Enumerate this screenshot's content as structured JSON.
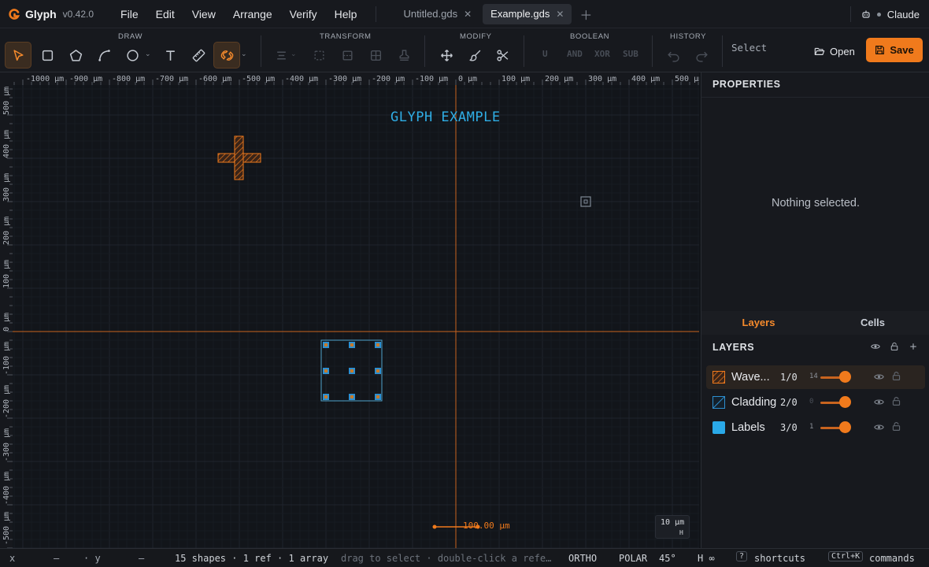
{
  "app": {
    "name": "Glyph",
    "version": "v0.42.0"
  },
  "menu": [
    "File",
    "Edit",
    "View",
    "Arrange",
    "Verify",
    "Help"
  ],
  "tabs": [
    {
      "label": "Untitled.gds",
      "active": false
    },
    {
      "label": "Example.gds",
      "active": true
    }
  ],
  "user": {
    "name": "Claude"
  },
  "toolbar": {
    "groups": {
      "draw": "DRAW",
      "transform": "TRANSFORM",
      "modify": "MODIFY",
      "boolean": "BOOLEAN",
      "history": "HISTORY"
    },
    "boolean_ops": [
      "U",
      "AND",
      "XOR",
      "SUB"
    ],
    "mode_text": "Select",
    "open_label": "Open",
    "save_label": "Save"
  },
  "rulers": {
    "x_ticks": [
      "-1000 µm",
      "-900 µm",
      "-800 µm",
      "-700 µm",
      "-600 µm",
      "-500 µm",
      "-400 µm",
      "-300 µm",
      "-200 µm",
      "-100 µm",
      "0 µm",
      "100 µm",
      "200 µm",
      "300 µm",
      "400 µm",
      "500 µm"
    ],
    "y_ticks": [
      "500 µm",
      "400 µm",
      "300 µm",
      "200 µm",
      "100 µm",
      "0 µm",
      "-100 µm",
      "-200 µm",
      "-300 µm",
      "-400 µm",
      "-500 µm"
    ]
  },
  "canvas": {
    "title_text": "GLYPH EXAMPLE",
    "scale_bar_label": "100.00 µm",
    "zoom_label": "10 µm",
    "zoom_sub": "H"
  },
  "properties": {
    "title": "PROPERTIES",
    "empty_text": "Nothing selected."
  },
  "panel_tabs": [
    "Layers",
    "Cells"
  ],
  "layers": {
    "title": "LAYERS",
    "items": [
      {
        "name": "Wave...",
        "number": "1/0",
        "count": "14",
        "color": "#f07a1c",
        "selected": true
      },
      {
        "name": "Cladding",
        "number": "2/0",
        "count": "0",
        "color": "#2d8fd0",
        "selected": false
      },
      {
        "name": "Labels",
        "number": "3/0",
        "count": "1",
        "color": "#2aa9e8",
        "selected": false
      }
    ]
  },
  "status": {
    "x_label": "x",
    "x_value": "—",
    "y_label": "· y",
    "y_value": "—",
    "counts": "15 shapes · 1 ref · 1 array",
    "hint": "drag to select · double-click a refe…",
    "ortho": "ORTHO",
    "polar": "POLAR",
    "polar_angle": "45°",
    "h_inf": "H ∞",
    "shortcuts_key": "?",
    "shortcuts_label": "shortcuts",
    "commands_key": "Ctrl+K",
    "commands_label": "commands"
  },
  "colors": {
    "accent": "#f07a1c",
    "label_blue": "#2faee6",
    "background": "#12151a"
  }
}
